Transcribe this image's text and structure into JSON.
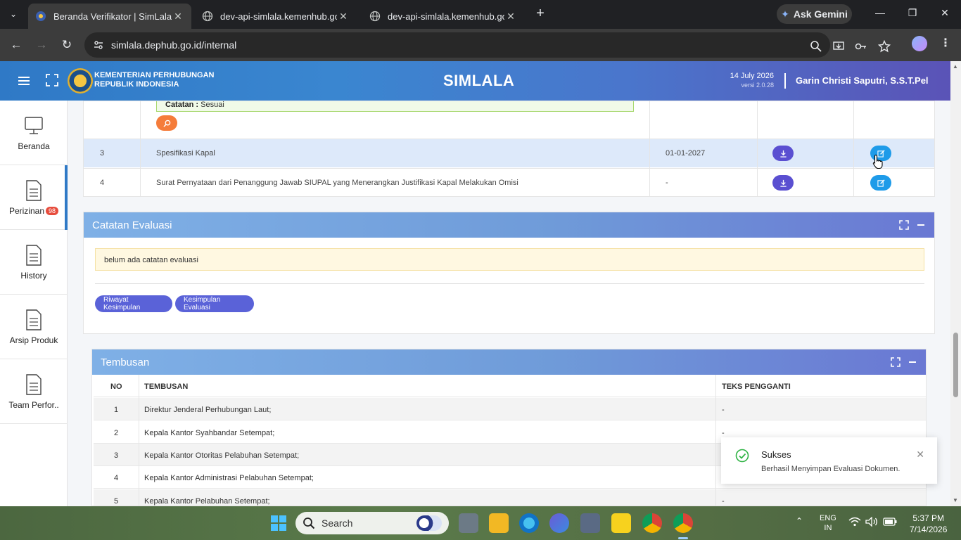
{
  "browser": {
    "tabs": [
      {
        "title": "Beranda Verifikator | SimLala",
        "active": true
      },
      {
        "title": "dev-api-simlala.kemenhub.go.id",
        "active": false
      },
      {
        "title": "dev-api-simlala.kemenhub.go.id",
        "active": false
      }
    ],
    "ask_gemini": "Ask Gemini",
    "url": "simlala.dephub.go.id/internal"
  },
  "header": {
    "ministry_line1": "KEMENTERIAN PERHUBUNGAN",
    "ministry_line2": "REPUBLIK INDONESIA",
    "app_title": "SIMLALA",
    "date": "14 July 2026",
    "version": "versi 2.0.28",
    "user": "Garin Christi Saputri, S.S.T.Pel"
  },
  "sidebar": {
    "items": [
      {
        "label": "Beranda",
        "icon": "monitor-icon"
      },
      {
        "label": "Perizinan",
        "icon": "document-icon",
        "badge": "98"
      },
      {
        "label": "History",
        "icon": "document-icon"
      },
      {
        "label": "Arsip Produk",
        "icon": "document-icon"
      },
      {
        "label": "Team Perfor..",
        "icon": "document-icon"
      }
    ]
  },
  "documents": {
    "catatan_label": "Catatan :",
    "catatan_value": "Sesuai",
    "rows": [
      {
        "no": "3",
        "name": "Spesifikasi Kapal",
        "date": "01-01-2027"
      },
      {
        "no": "4",
        "name": "Surat Pernyataan dari Penanggung Jawab SIUPAL yang Menerangkan Justifikasi Kapal Melakukan Omisi",
        "date": "-"
      }
    ]
  },
  "evaluasi": {
    "title": "Catatan Evaluasi",
    "note": "belum ada catatan evaluasi",
    "btn_riwayat": "Riwayat Kesimpulan",
    "btn_kesimpulan": "Kesimpulan Evaluasi"
  },
  "tembusan": {
    "title": "Tembusan",
    "columns": [
      "NO",
      "TEMBUSAN",
      "TEKS PENGGANTI"
    ],
    "rows": [
      {
        "no": "1",
        "name": "Direktur Jenderal Perhubungan Laut;",
        "teks": "-"
      },
      {
        "no": "2",
        "name": "Kepala Kantor Syahbandar Setempat;",
        "teks": "-"
      },
      {
        "no": "3",
        "name": "Kepala Kantor Otoritas Pelabuhan Setempat;",
        "teks": ""
      },
      {
        "no": "4",
        "name": "Kepala Kantor Administrasi Pelabuhan Setempat;",
        "teks": ""
      },
      {
        "no": "5",
        "name": "Kepala Kantor Pelabuhan Setempat;",
        "teks": "-"
      }
    ]
  },
  "toast": {
    "title": "Sukses",
    "message": "Berhasil Menyimpan Evaluasi Dokumen."
  },
  "taskbar": {
    "search_placeholder": "Search",
    "lang_line1": "ENG",
    "lang_line2": "IN",
    "time": "5:37 PM",
    "date": "7/14/2026"
  },
  "colors": {
    "header_start": "#2f79c6",
    "header_end": "#5b52b6",
    "download_btn": "#5a4fd1",
    "edit_btn": "#1e9be9",
    "search_btn": "#f57c3a",
    "badge": "#e74c3c"
  }
}
